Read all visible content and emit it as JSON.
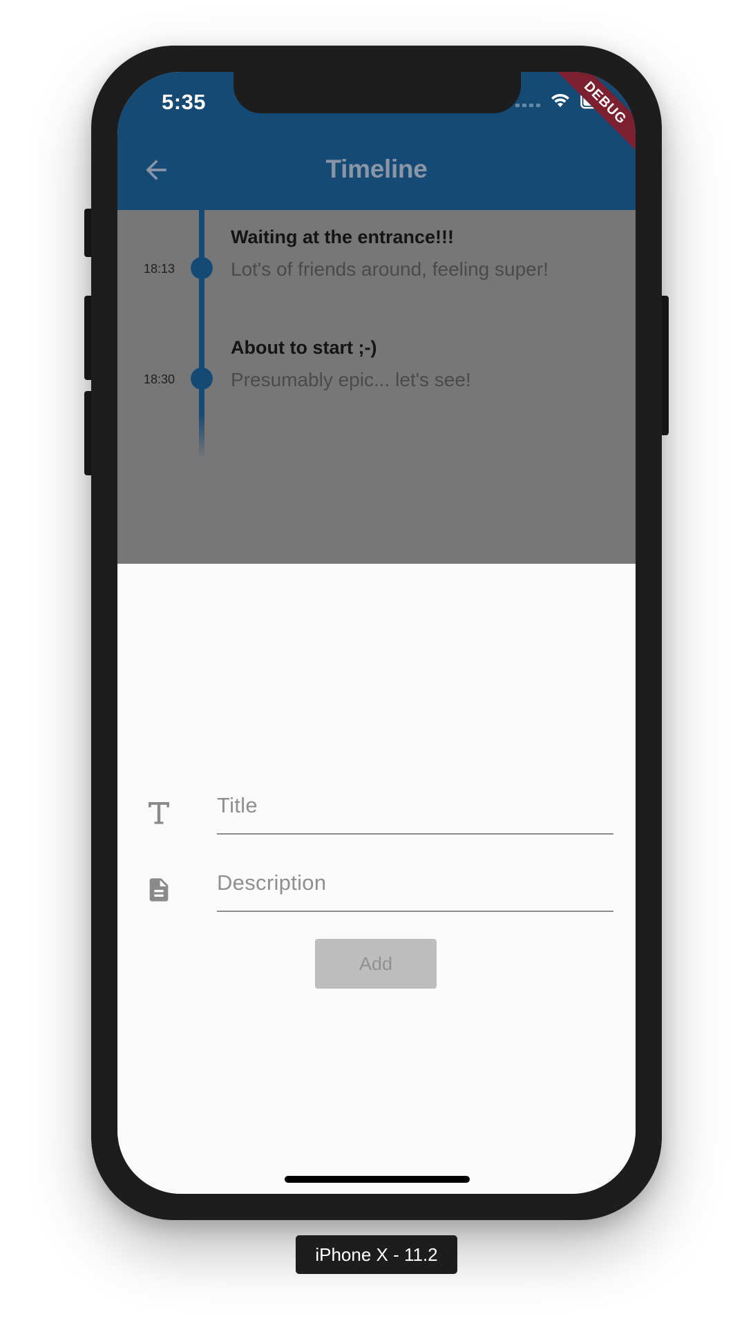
{
  "device": {
    "label": "iPhone X - 11.2"
  },
  "status_bar": {
    "time": "5:35",
    "icons": [
      "signal-icon",
      "wifi-icon",
      "battery-icon"
    ]
  },
  "app_bar": {
    "title": "Timeline",
    "back_icon": "arrow-back-icon",
    "color": "#154a74",
    "debug_banner": "DEBUG"
  },
  "timeline": {
    "accent": "#154a74",
    "items": [
      {
        "time": "18:13",
        "title": "Waiting at the entrance!!!",
        "description": "Lot's of friends around, feeling super!"
      },
      {
        "time": "18:30",
        "title": "About to start ;-)",
        "description": "Presumably epic... let's see!"
      }
    ]
  },
  "form": {
    "title_icon": "text-fields-icon",
    "title_placeholder": "Title",
    "description_icon": "description-icon",
    "description_placeholder": "Description",
    "add_label": "Add"
  }
}
